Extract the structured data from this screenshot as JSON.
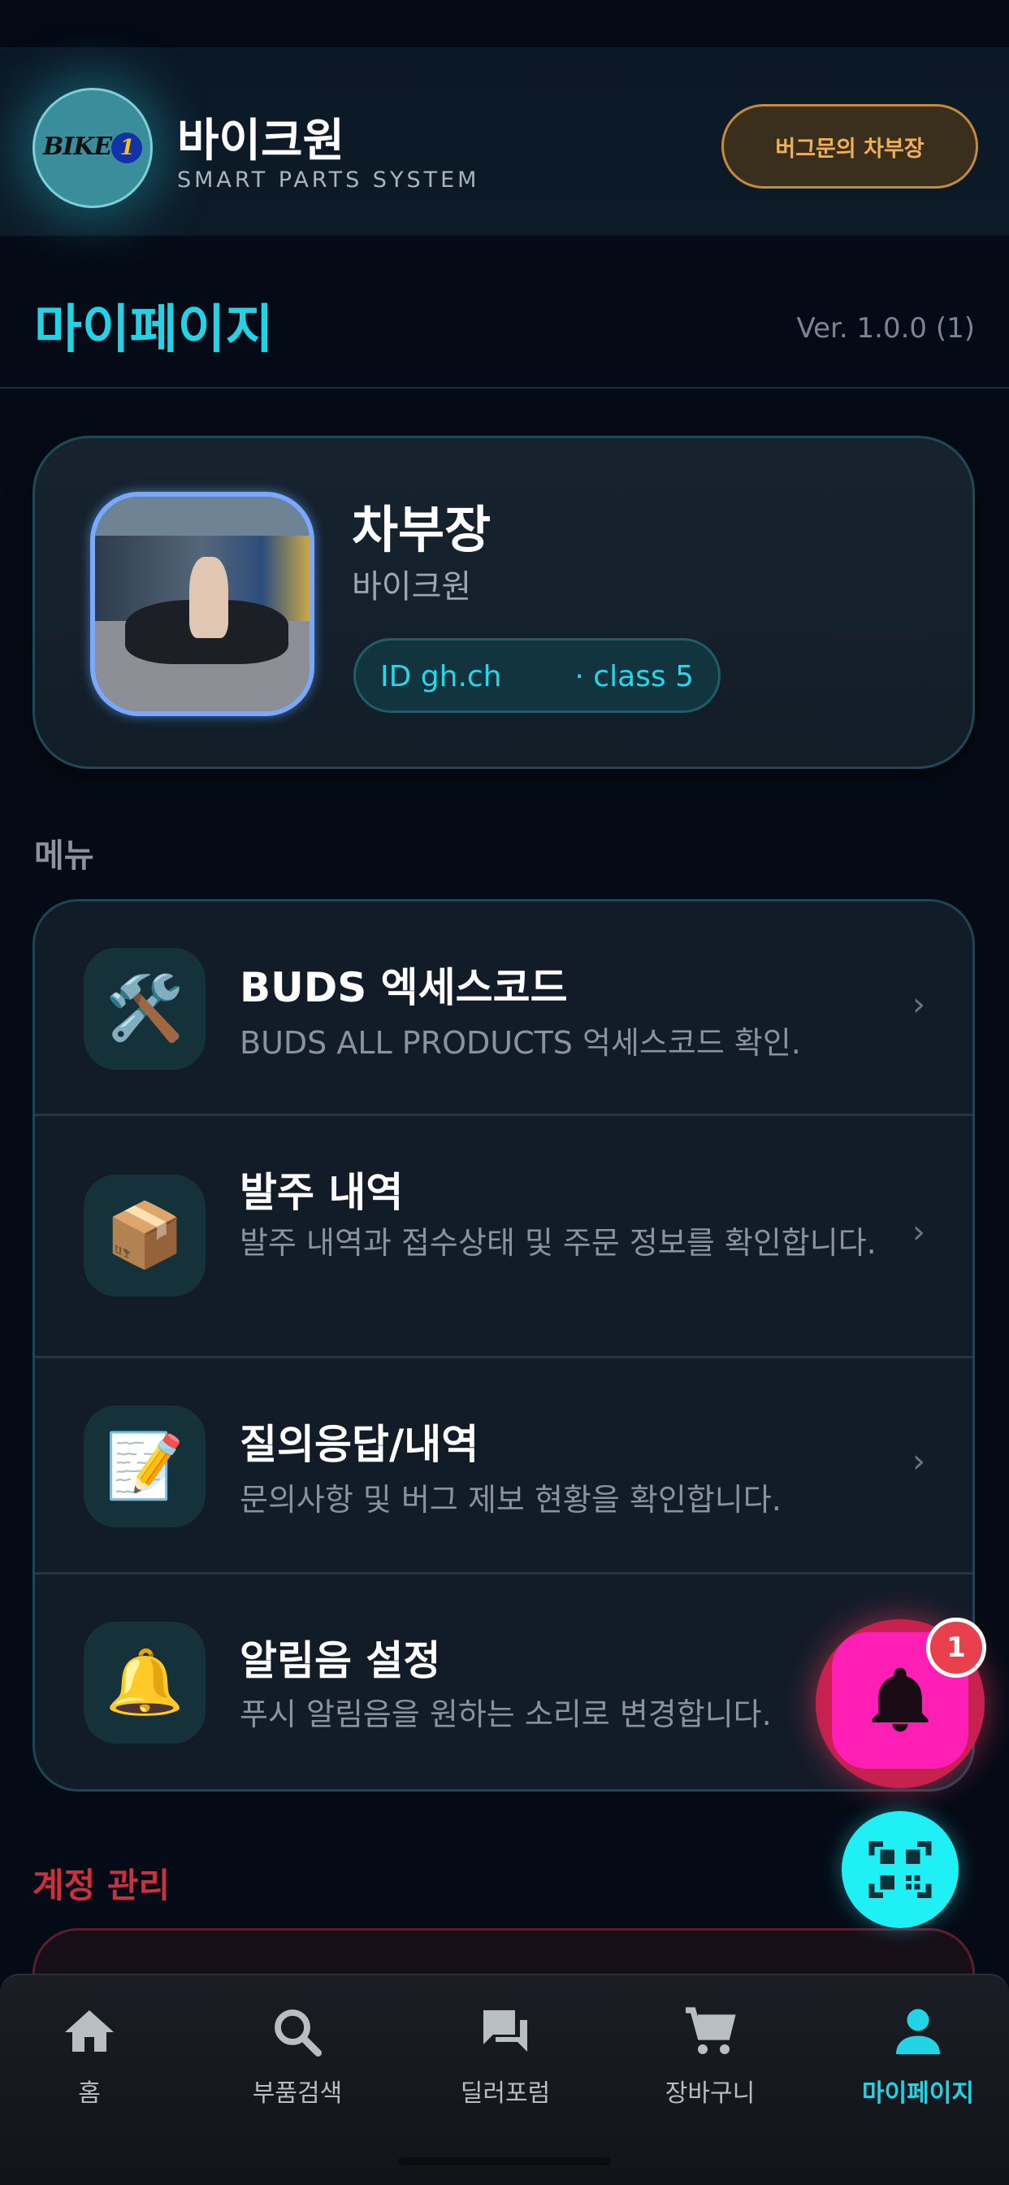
{
  "header": {
    "logo_text": "BIKE",
    "logo_digit": "1",
    "brand_title": "바이크원",
    "brand_subtitle": "SMART PARTS SYSTEM",
    "user_chip": "버그문의 차부장"
  },
  "page": {
    "title": "마이페이지",
    "version": "Ver. 1.0.0 (1)"
  },
  "profile": {
    "name": "차부장",
    "company": "바이크원",
    "id_label": "ID gh.ch",
    "class_label": "· class 5"
  },
  "menu": {
    "section_label": "메뉴",
    "items": [
      {
        "icon": "hammer-wrench-icon",
        "glyph": "🛠️",
        "title": "BUDS 엑세스코드",
        "desc": "BUDS ALL PRODUCTS 억세스코드 확인."
      },
      {
        "icon": "package-icon",
        "glyph": "📦",
        "title": "발주 내역",
        "desc": "발주 내역과 접수상태 및 주문 정보를 확인합니다."
      },
      {
        "icon": "memo-icon",
        "glyph": "📝",
        "title": "질의응답/내역",
        "desc": "문의사항 및 버그 제보 현황을 확인합니다."
      },
      {
        "icon": "bell-icon",
        "glyph": "🔔",
        "title": "알림음 설정",
        "desc": "푸시 알림음을 원하는 소리로 변경합니다."
      }
    ],
    "chevron": "›"
  },
  "account": {
    "section_label": "계정 관리"
  },
  "fab": {
    "notification_count": "1"
  },
  "bottom_nav": {
    "items": [
      {
        "label": "홈",
        "icon": "home-icon",
        "active": false
      },
      {
        "label": "부품검색",
        "icon": "search-icon",
        "active": false
      },
      {
        "label": "딜러포럼",
        "icon": "forum-icon",
        "active": false
      },
      {
        "label": "장바구니",
        "icon": "cart-icon",
        "active": false
      },
      {
        "label": "마이페이지",
        "icon": "person-icon",
        "active": true
      }
    ]
  },
  "colors": {
    "accent": "#22d3e6",
    "chip": "#f0b053",
    "danger": "#c8313d",
    "fab_bell": "#ff1fb5",
    "fab_qr": "#1ff0f5"
  }
}
